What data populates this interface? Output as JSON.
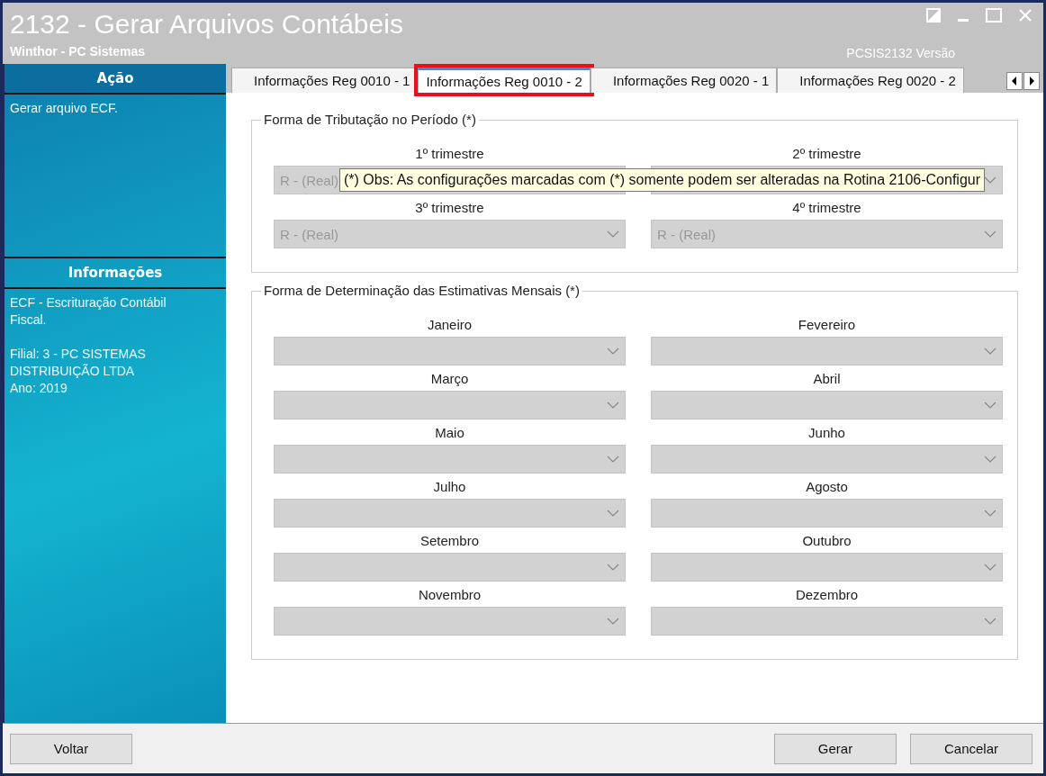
{
  "window": {
    "title": "2132 - Gerar Arquivos Contábeis",
    "subtitle": "Winthor - PC Sistemas",
    "version": "PCSIS2132  Versão"
  },
  "sidebar": {
    "sections": [
      {
        "title": "Ação",
        "paragraphs": [
          [
            "Gerar arquivo ECF."
          ]
        ]
      },
      {
        "title": "Informações",
        "paragraphs": [
          [
            "ECF - Escrituração Contábil Fiscal."
          ],
          [
            "Filial: 3 - PC SISTEMAS DISTRIBUIÇÃO LTDA",
            "Ano: 2019"
          ]
        ]
      }
    ]
  },
  "tabs": [
    {
      "label": "Informações Reg 0010 - 1",
      "selected": false,
      "highlighted": false
    },
    {
      "label": "Informações Reg 0010 - 2",
      "selected": true,
      "highlighted": true
    },
    {
      "label": "Informações Reg 0020 - 1",
      "selected": false,
      "highlighted": false
    },
    {
      "label": "Informações Reg 0020 - 2",
      "selected": false,
      "highlighted": false
    }
  ],
  "groups": [
    {
      "title": "Forma de Tributação no Período (*)",
      "fields": [
        {
          "label": "1º trimestre",
          "value": "R - (Real)"
        },
        {
          "label": "2º trimestre"
        },
        {
          "label": "3º trimestre",
          "value": "R - (Real)"
        },
        {
          "label": "4º trimestre",
          "value": "R - (Real)"
        }
      ]
    },
    {
      "title": "Forma de Determinação das Estimativas Mensais (*)",
      "fields": [
        {
          "label": "Janeiro"
        },
        {
          "label": "Fevereiro"
        },
        {
          "label": "Março"
        },
        {
          "label": "Abril"
        },
        {
          "label": "Maio"
        },
        {
          "label": "Junho"
        },
        {
          "label": "Julho"
        },
        {
          "label": "Agosto"
        },
        {
          "label": "Setembro"
        },
        {
          "label": "Outubro"
        },
        {
          "label": "Novembro"
        },
        {
          "label": "Dezembro"
        }
      ]
    }
  ],
  "tooltip": "(*) Obs: As configurações marcadas com (*) somente podem ser alteradas na Rotina 2106-Configur",
  "buttons": {
    "left": [
      "Voltar"
    ],
    "right": [
      "Gerar",
      "Cancelar"
    ]
  }
}
